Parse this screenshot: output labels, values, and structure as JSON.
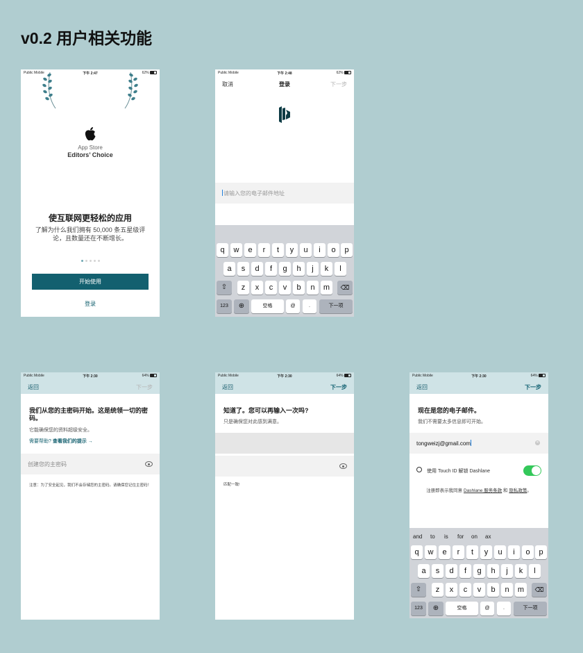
{
  "page": {
    "title": "v0.2 用户相关功能"
  },
  "status": {
    "carrier": "Public Mobile",
    "p1": {
      "time": "下午 2:47",
      "battery": "62%"
    },
    "p2": {
      "time": "下午 2:48",
      "battery": "62%"
    },
    "p3": {
      "time": "下午 2:30",
      "battery": "64%"
    },
    "p4": {
      "time": "下午 2:30",
      "battery": "64%"
    },
    "p5": {
      "time": "下午 2:30",
      "battery": "64%"
    }
  },
  "welcome": {
    "award_line1": "App Store",
    "award_line2": "Editors’ Choice",
    "title": "使互联网更轻松的应用",
    "subtitle": "了解为什么我们拥有 50,000 条五星级评论，且数量还在不断增长。",
    "start_button": "开始使用",
    "login_link": "登录",
    "page_count": 5,
    "active_page": 1
  },
  "login": {
    "cancel": "取消",
    "title": "登录",
    "next": "下一步",
    "email_placeholder": "请输入您的电子邮件地址"
  },
  "keyboard": {
    "row1": [
      "q",
      "w",
      "e",
      "r",
      "t",
      "y",
      "u",
      "i",
      "o",
      "p"
    ],
    "row2": [
      "a",
      "s",
      "d",
      "f",
      "g",
      "h",
      "j",
      "k",
      "l"
    ],
    "row3": [
      "z",
      "x",
      "c",
      "v",
      "b",
      "n",
      "m"
    ],
    "num_key": "123",
    "globe_icon": "globe-icon",
    "space": "空格",
    "at": "@",
    "dot": ".",
    "next_key": "下一项",
    "suggestions": [
      "and",
      "to",
      "is",
      "for",
      "on",
      "ax"
    ]
  },
  "create_password": {
    "back": "返回",
    "next": "下一步",
    "title": "我们从您的主密码开始。这是统领一切的密码。",
    "subtitle": "它能确保您的资料超级安全。",
    "help_question": "需要帮助?",
    "help_link": "查看我们的提示 →",
    "placeholder": "创建您的主密码",
    "note": "注意：为了安全起见，我们不会存储您的主密码。请确保您记住主密码！"
  },
  "confirm_password": {
    "back": "返回",
    "next": "下一步",
    "title": "知道了。您可以再输入一次吗?",
    "subtitle": "只是确保您对此感到满意。",
    "match_text": "匹配一致!"
  },
  "email_confirm": {
    "back": "返回",
    "next": "下一步",
    "title": "现在是您的电子邮件。",
    "subtitle": "我们不需要太多信息即可开始。",
    "email_value": "tongweizj@gmail.com",
    "touch_id_label": "使用 Touch ID 解锁 Dashlane",
    "touch_id_enabled": true,
    "terms_prefix": "注册即表示我同意",
    "terms_link": "Dashlane 服务条款",
    "terms_and": "和",
    "privacy_link": "隐私政策",
    "terms_suffix": "。"
  },
  "colors": {
    "background": "#b0cdd0",
    "brand": "#13606f",
    "toggle_on": "#34c85a"
  }
}
